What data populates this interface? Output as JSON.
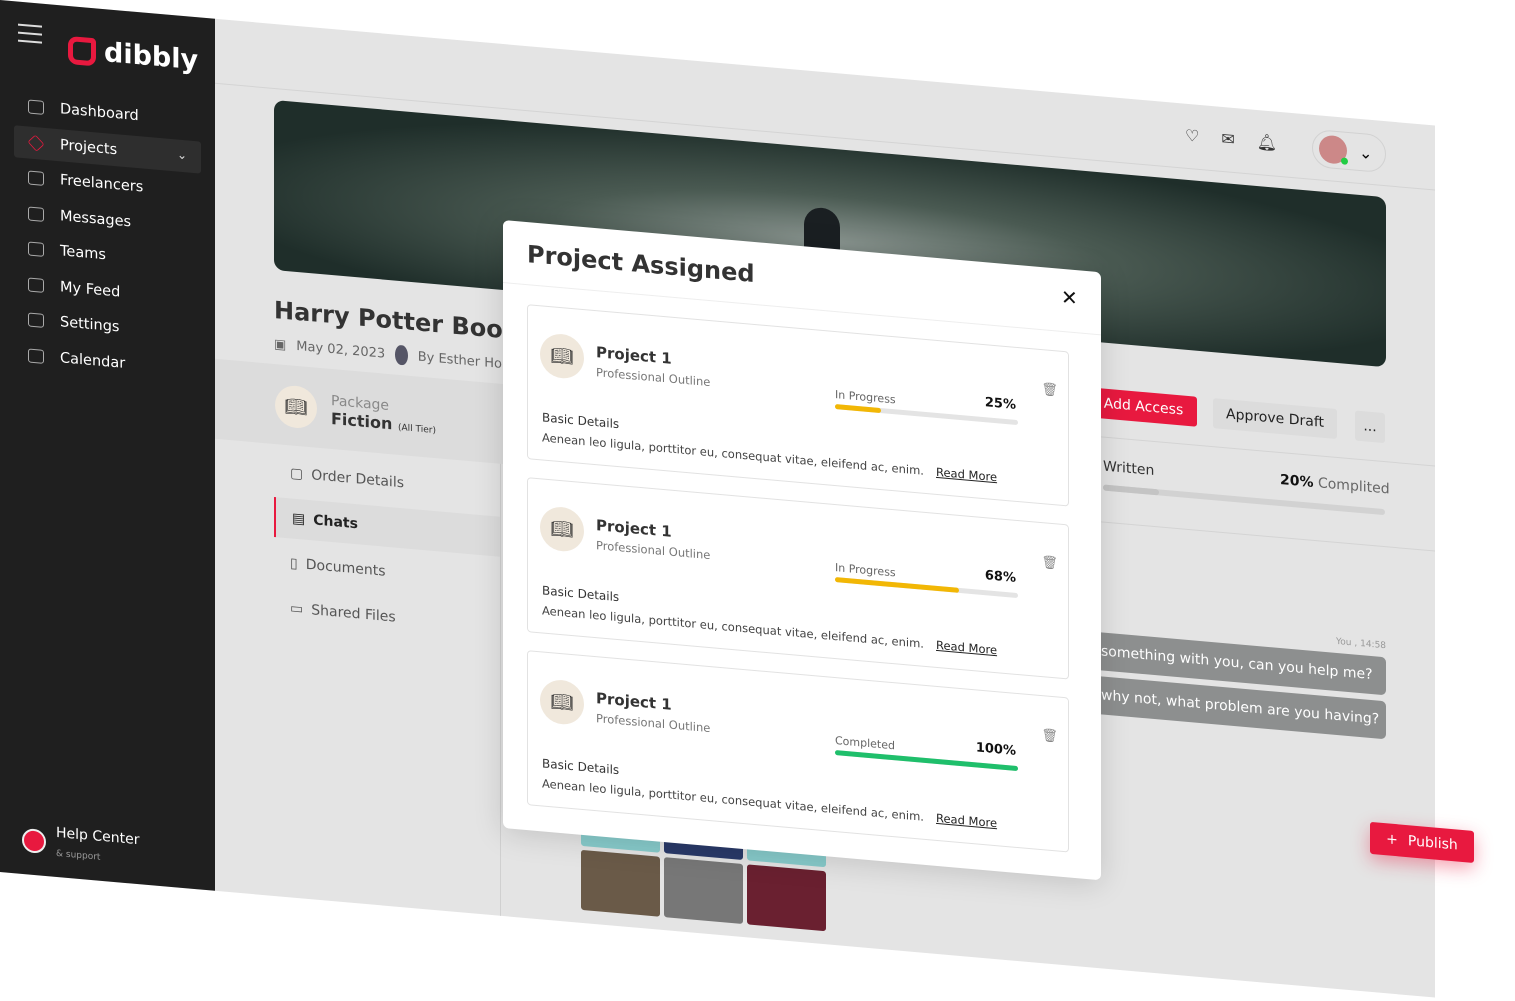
{
  "app": {
    "logo": "dibbly"
  },
  "sidebar": {
    "items": [
      {
        "label": "Dashboard",
        "icon": "grid-icon"
      },
      {
        "label": "Projects",
        "icon": "layers-icon",
        "active": true
      },
      {
        "label": "Freelancers",
        "icon": "users-icon"
      },
      {
        "label": "Messages",
        "icon": "message-icon"
      },
      {
        "label": "Teams",
        "icon": "team-icon"
      },
      {
        "label": "My Feed",
        "icon": "feed-icon"
      },
      {
        "label": "Settings",
        "icon": "gear-icon"
      },
      {
        "label": "Calendar",
        "icon": "calendar-icon"
      }
    ],
    "help": {
      "title": "Help Center",
      "subtitle": "& support"
    }
  },
  "header": {
    "icons": [
      "heart-icon",
      "mail-icon",
      "bell-icon"
    ]
  },
  "project": {
    "title": "Harry Potter Book W",
    "date": "May 02, 2023",
    "author": "By Esther Ho",
    "package_label": "Package",
    "package_name": "Fiction",
    "package_tier": "(All Tier)"
  },
  "subnav": [
    "Order Details",
    "Chats",
    "Documents",
    "Shared Files"
  ],
  "actions": {
    "add_access": "Add Access",
    "approve_draft": "Approve Draft",
    "more": "..."
  },
  "progress": {
    "label": "Written",
    "percent_text": "20%",
    "suffix": "Complited",
    "percent": 20
  },
  "chat": {
    "time": "You , 14:58",
    "messages": [
      "something with you, can you help me?",
      "why not, what problem are you having?"
    ]
  },
  "publish": {
    "label": "Publish",
    "icon": "+"
  },
  "modal": {
    "title": "Project Assigned",
    "close": "✕",
    "cards": [
      {
        "title": "Project 1",
        "subtitle": "Professional Outline",
        "status": "In Progress",
        "percent_text": "25%",
        "percent": 25,
        "color": "#f2b705",
        "basic": "Basic Details",
        "desc": "Aenean leo ligula, porttitor eu, consequat vitae, eleifend ac, enim.",
        "read_more": "Read More"
      },
      {
        "title": "Project 1",
        "subtitle": "Professional Outline",
        "status": "In Progress",
        "percent_text": "68%",
        "percent": 68,
        "color": "#f2b705",
        "basic": "Basic Details",
        "desc": "Aenean leo ligula, porttitor eu, consequat vitae, eleifend ac, enim.",
        "read_more": "Read More"
      },
      {
        "title": "Project 1",
        "subtitle": "Professional Outline",
        "status": "Completed",
        "percent_text": "100%",
        "percent": 100,
        "color": "#1fbf6b",
        "basic": "Basic Details",
        "desc": "Aenean leo ligula, porttitor eu, consequat vitae, eleifend ac, enim.",
        "read_more": "Read More"
      }
    ]
  },
  "colors": {
    "accent": "#e8193f",
    "sidebar": "#1f1f1f"
  }
}
